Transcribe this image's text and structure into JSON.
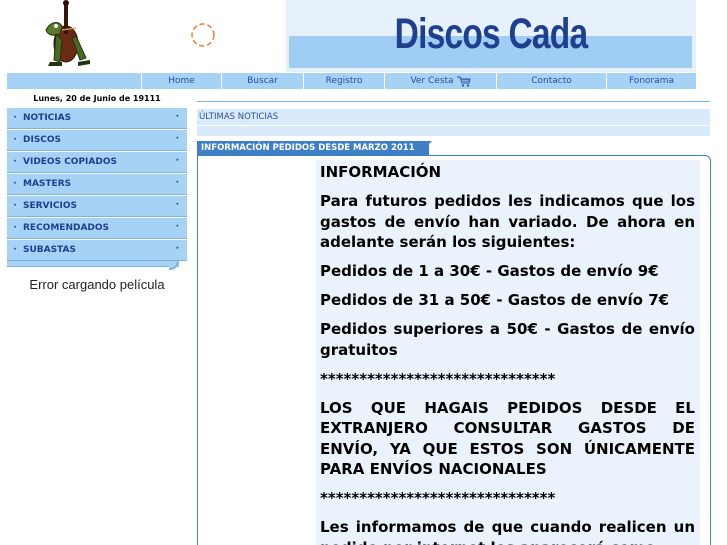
{
  "header": {
    "site_title": "Discos Cada",
    "logo_icon": "alligator-playing-double-bass-logo",
    "loading_icon": "loading-spinner-icon"
  },
  "nav": {
    "items": [
      {
        "label": ""
      },
      {
        "label": "Home"
      },
      {
        "label": "Buscar"
      },
      {
        "label": "Registro"
      },
      {
        "label": "Ver Cesta",
        "icon": "shopping-cart-icon"
      },
      {
        "label": "Contacto"
      },
      {
        "label": "Fonorama"
      }
    ]
  },
  "sidebar": {
    "date": "Lunes, 20 de Junio de 19111",
    "items": [
      {
        "label": "NOTICIAS"
      },
      {
        "label": "DISCOS"
      },
      {
        "label": "VIDEOS COPIADOS"
      },
      {
        "label": "MASTERS"
      },
      {
        "label": "SERVICIOS"
      },
      {
        "label": "RECOMENDADOS"
      },
      {
        "label": "SUBASTAS"
      }
    ],
    "bullet": "·",
    "movie_error": "Error cargando película"
  },
  "main": {
    "section_title": "ÚLTIMAS NOTICIAS",
    "article_tab": "INFORMACIÓN PEDIDOS DESDE MARZO 2011",
    "paragraphs": [
      "INFORMACIÓN",
      "Para futuros pedidos les indicamos que los gastos de envío han variado. De ahora en adelante serán los siguientes:",
      "Pedidos de 1 a 30€ - Gastos de envío 9€",
      "Pedidos de 31 a 50€ - Gastos de envío 7€",
      "Pedidos superiores a 50€ - Gastos de envío gratuitos",
      "******************************",
      "LOS QUE HAGAIS PEDIDOS DESDE EL EXTRANJERO CONSULTAR GASTOS DE ENVÍO, YA QUE ESTOS SON ÚNICAMENTE PARA ENVÍOS NACIONALES",
      "******************************",
      "Les informamos de que cuando realicen un pedido por internet les aparecerá como"
    ]
  },
  "colors": {
    "nav_bg": "#a6d2f6",
    "banner_stripe": "#9fcdf3",
    "title_blue": "#1f3f8f",
    "tab_blue": "#3f7fc4",
    "panel_bg": "#eaf3fb"
  }
}
